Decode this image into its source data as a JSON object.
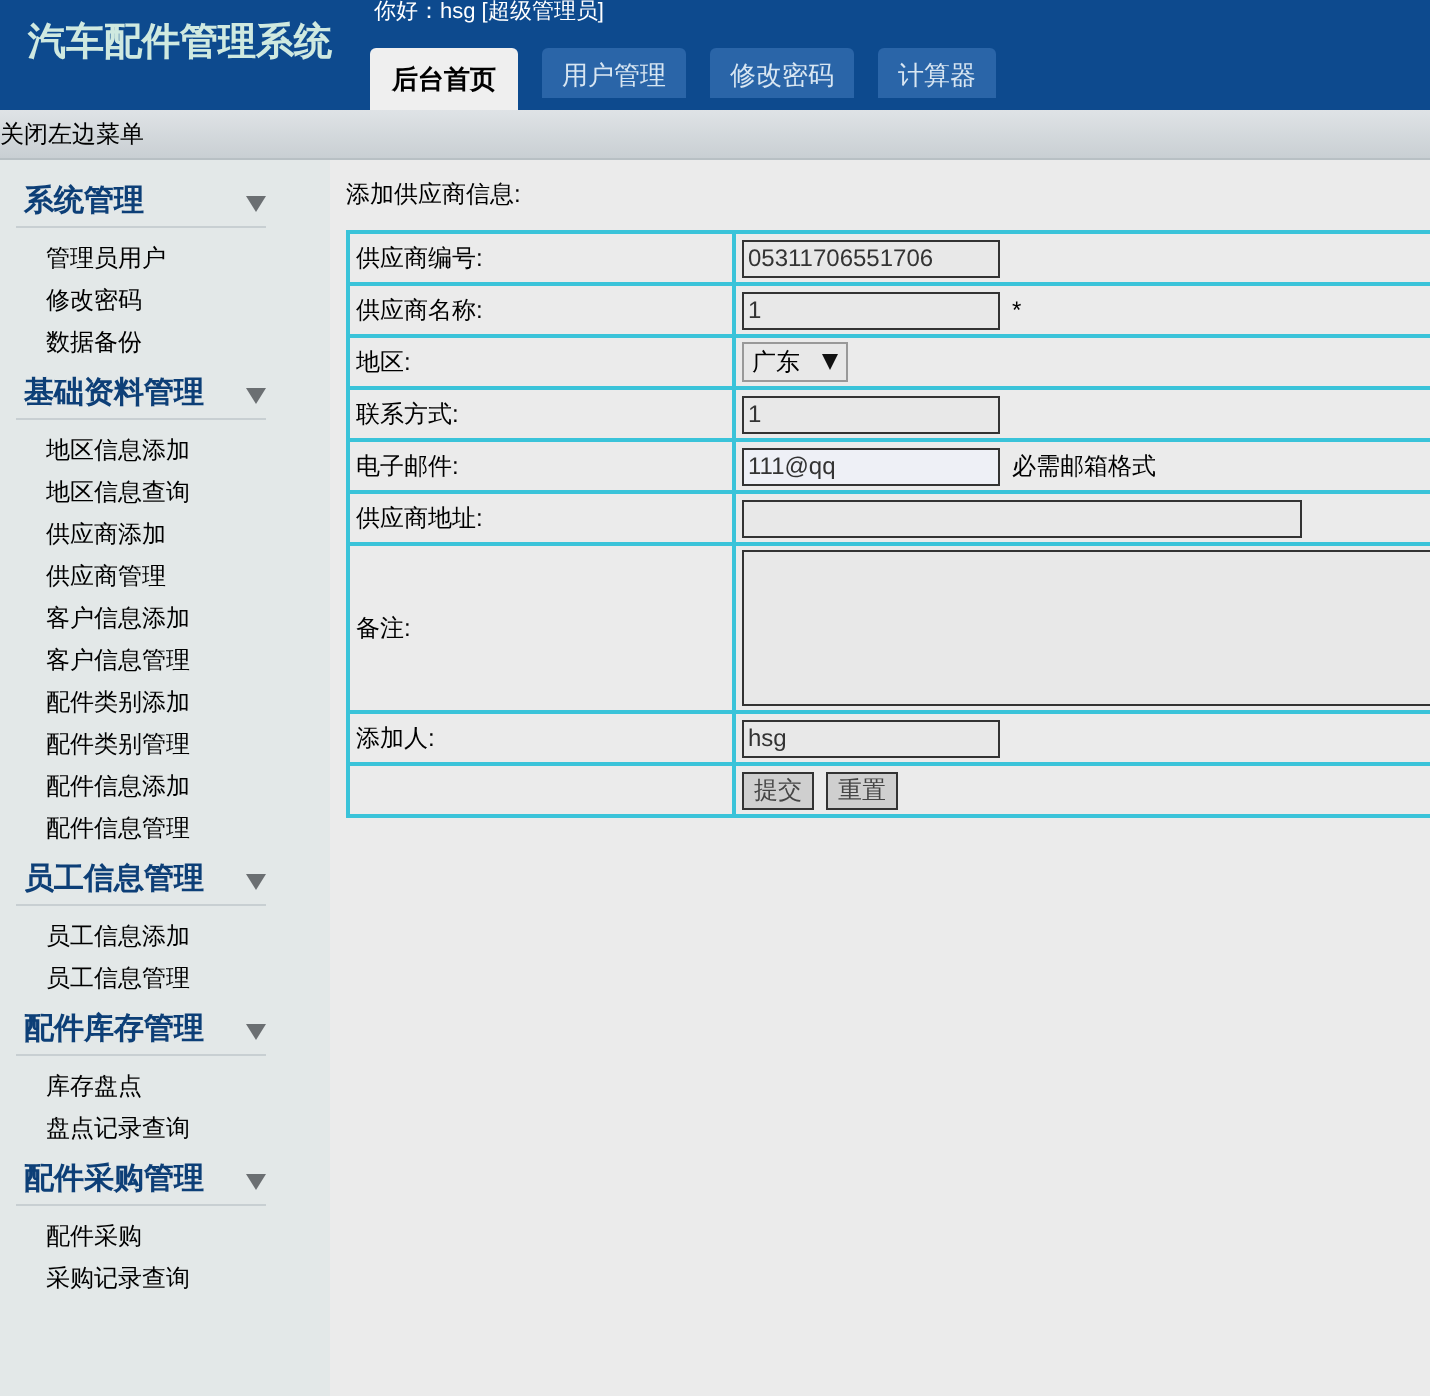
{
  "header": {
    "title": "汽车配件管理系统",
    "greeting": "你好：hsg [超级管理员]"
  },
  "tabs": [
    {
      "label": "后台首页",
      "selected": true
    },
    {
      "label": "用户管理",
      "selected": false
    },
    {
      "label": "修改密码",
      "selected": false
    },
    {
      "label": "计算器",
      "selected": false
    }
  ],
  "toolbar": {
    "toggle_menu": "关闭左边菜单"
  },
  "sidebar": {
    "groups": [
      {
        "title": "系统管理",
        "items": [
          "管理员用户",
          "修改密码",
          "数据备份"
        ]
      },
      {
        "title": "基础资料管理",
        "items": [
          "地区信息添加",
          "地区信息查询",
          "供应商添加",
          "供应商管理",
          "客户信息添加",
          "客户信息管理",
          "配件类别添加",
          "配件类别管理",
          "配件信息添加",
          "配件信息管理"
        ]
      },
      {
        "title": "员工信息管理",
        "items": [
          "员工信息添加",
          "员工信息管理"
        ]
      },
      {
        "title": "配件库存管理",
        "items": [
          "库存盘点",
          "盘点记录查询"
        ]
      },
      {
        "title": "配件采购管理",
        "items": [
          "配件采购",
          "采购记录查询"
        ]
      }
    ]
  },
  "form": {
    "title": "添加供应商信息:",
    "rows": [
      {
        "kind": "input",
        "label": "供应商编号:",
        "value": "05311706551706",
        "focused": false
      },
      {
        "kind": "input",
        "label": "供应商名称:",
        "value": "1",
        "note": "*",
        "focused": false
      },
      {
        "kind": "select",
        "label": "地区:",
        "value": "广东"
      },
      {
        "kind": "input",
        "label": "联系方式:",
        "value": "1",
        "focused": false
      },
      {
        "kind": "input",
        "label": "电子邮件:",
        "value": "111@qq",
        "note": "必需邮箱格式",
        "focused": true
      },
      {
        "kind": "wide",
        "label": "供应商地址:",
        "focused": false
      },
      {
        "kind": "textarea",
        "label": "备注:"
      },
      {
        "kind": "input",
        "label": "添加人:",
        "value": "hsg",
        "focused": false
      },
      {
        "kind": "buttons",
        "buttons": [
          "提交",
          "重置"
        ]
      }
    ]
  }
}
